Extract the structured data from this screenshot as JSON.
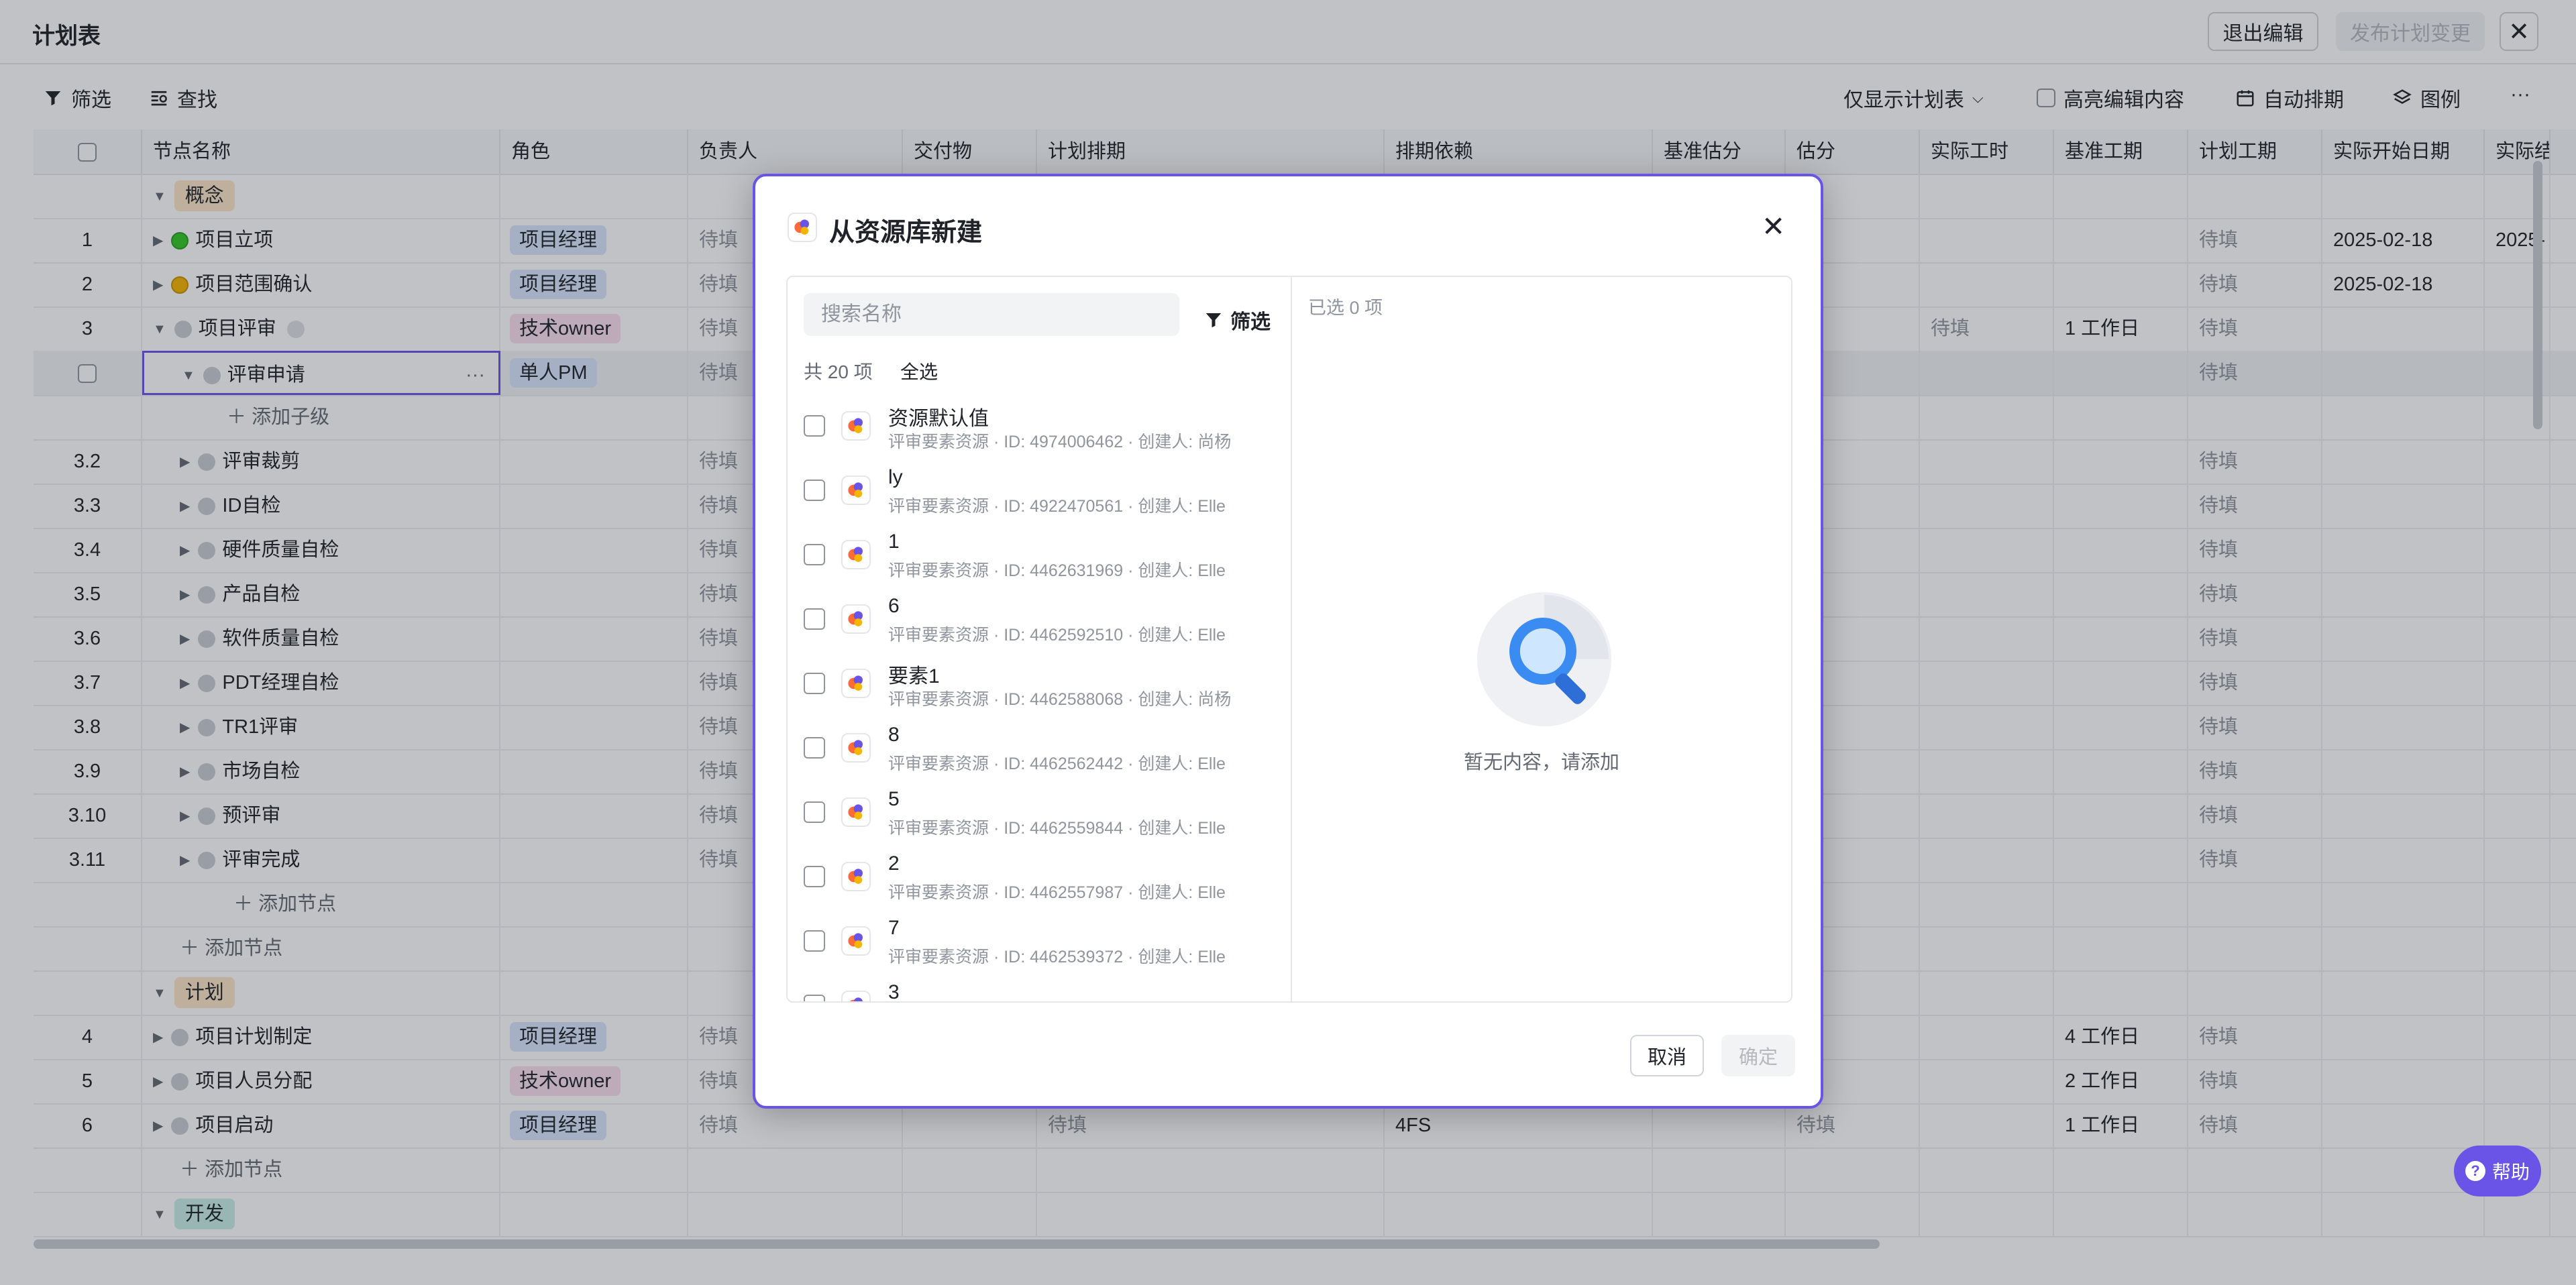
{
  "header": {
    "title": "计划表",
    "exit_edit": "退出编辑",
    "publish": "发布计划变更",
    "close": "✕"
  },
  "toolbar": {
    "filter": "筛选",
    "find": "查找",
    "show_plan_only": "仅显示计划表",
    "highlight_edits": "高亮编辑内容",
    "auto_schedule": "自动排期",
    "legend": "图例",
    "more": "···"
  },
  "table": {
    "columns": [
      "节点名称",
      "角色",
      "负责人",
      "交付物",
      "计划排期",
      "排期依赖",
      "基准估分",
      "估分",
      "实际工时",
      "基准工期",
      "计划工期",
      "实际开始日期",
      "实际结"
    ],
    "pending": "待填",
    "add_child": "添加子级",
    "add_node": "添加节点",
    "rows": [
      {
        "kind": "group",
        "label": "概念",
        "color": "concept"
      },
      {
        "kind": "node",
        "num": "1",
        "name": "项目立项",
        "dot": "green",
        "role": "项目经理",
        "role_color": "blue",
        "owner": "待填",
        "plan_dur": "待填",
        "start": "2025-02-18",
        "end": "2025-"
      },
      {
        "kind": "node",
        "num": "2",
        "name": "项目范围确认",
        "dot": "yellow",
        "role": "项目经理",
        "role_color": "blue",
        "owner": "待填",
        "plan_dur": "待填",
        "start": "2025-02-18"
      },
      {
        "kind": "node",
        "num": "3",
        "name": "项目评审",
        "dot": "gray",
        "role": "技术owner",
        "role_color": "pink",
        "owner": "待填",
        "actual_hours": "待填",
        "base_dur": "1 工作日",
        "plan_dur": "待填",
        "expanded": true
      },
      {
        "kind": "node",
        "num": "",
        "name": "评审申请",
        "dot": "gray",
        "role": "单人PM",
        "role_color": "blue",
        "owner": "待填",
        "plan_dur": "待填",
        "indent": 1,
        "selected": true
      },
      {
        "kind": "addchild"
      },
      {
        "kind": "node",
        "num": "3.2",
        "name": "评审裁剪",
        "dot": "gray",
        "owner": "待填",
        "plan_dur": "待填",
        "indent": 1
      },
      {
        "kind": "node",
        "num": "3.3",
        "name": "ID自检",
        "dot": "gray",
        "owner": "待填",
        "plan_dur": "待填",
        "indent": 1
      },
      {
        "kind": "node",
        "num": "3.4",
        "name": "硬件质量自检",
        "dot": "gray",
        "owner": "待填",
        "plan_dur": "待填",
        "indent": 1
      },
      {
        "kind": "node",
        "num": "3.5",
        "name": "产品自检",
        "dot": "gray",
        "owner": "待填",
        "plan_dur": "待填",
        "indent": 1
      },
      {
        "kind": "node",
        "num": "3.6",
        "name": "软件质量自检",
        "dot": "gray",
        "owner": "待填",
        "plan_dur": "待填",
        "indent": 1
      },
      {
        "kind": "node",
        "num": "3.7",
        "name": "PDT经理自检",
        "dot": "gray",
        "owner": "待填",
        "plan_dur": "待填",
        "indent": 1
      },
      {
        "kind": "node",
        "num": "3.8",
        "name": "TR1评审",
        "dot": "gray",
        "owner": "待填",
        "plan_dur": "待填",
        "indent": 1
      },
      {
        "kind": "node",
        "num": "3.9",
        "name": "市场自检",
        "dot": "gray",
        "owner": "待填",
        "plan_dur": "待填",
        "indent": 1
      },
      {
        "kind": "node",
        "num": "3.10",
        "name": "预评审",
        "dot": "gray",
        "owner": "待填",
        "plan_dur": "待填",
        "indent": 1
      },
      {
        "kind": "node",
        "num": "3.11",
        "name": "评审完成",
        "dot": "gray",
        "owner": "待填",
        "plan_dur": "待填",
        "indent": 1
      },
      {
        "kind": "addnode",
        "indent": 1
      },
      {
        "kind": "addnode",
        "indent": 0
      },
      {
        "kind": "group",
        "label": "计划",
        "color": "plan"
      },
      {
        "kind": "node",
        "num": "4",
        "name": "项目计划制定",
        "dot": "gray",
        "role": "项目经理",
        "role_color": "blue",
        "owner": "待填",
        "base_dur": "4 工作日",
        "plan_dur": "待填"
      },
      {
        "kind": "node",
        "num": "5",
        "name": "项目人员分配",
        "dot": "gray",
        "role": "技术owner",
        "role_color": "pink",
        "owner": "待填",
        "base_dur": "2 工作日",
        "plan_dur": "待填"
      },
      {
        "kind": "node",
        "num": "6",
        "name": "项目启动",
        "dot": "gray",
        "role": "项目经理",
        "role_color": "blue",
        "owner": "待填",
        "schedule": "待填",
        "dependency": "4FS",
        "estimate": "待填",
        "base_dur": "1 工作日",
        "plan_dur": "待填"
      },
      {
        "kind": "addnode",
        "indent": 0
      },
      {
        "kind": "group",
        "label": "开发",
        "color": "dev"
      }
    ]
  },
  "modal": {
    "title": "从资源库新建",
    "search_placeholder": "搜索名称",
    "filter": "筛选",
    "total": "共 20 项",
    "select_all": "全选",
    "selected": "已选 0 项",
    "empty": "暂无内容，请添加",
    "cancel": "取消",
    "confirm": "确定",
    "items": [
      {
        "name": "资源默认值",
        "sub": "评审要素资源 · ID: 4974006462 · 创建人: 尚杨"
      },
      {
        "name": "ly",
        "sub": "评审要素资源 · ID: 4922470561 · 创建人: Elle"
      },
      {
        "name": "1",
        "sub": "评审要素资源 · ID: 4462631969 · 创建人: Elle"
      },
      {
        "name": "6",
        "sub": "评审要素资源 · ID: 4462592510 · 创建人: Elle"
      },
      {
        "name": "要素1",
        "sub": "评审要素资源 · ID: 4462588068 · 创建人: 尚杨"
      },
      {
        "name": "8",
        "sub": "评审要素资源 · ID: 4462562442 · 创建人: Elle"
      },
      {
        "name": "5",
        "sub": "评审要素资源 · ID: 4462559844 · 创建人: Elle"
      },
      {
        "name": "2",
        "sub": "评审要素资源 · ID: 4462557987 · 创建人: Elle"
      },
      {
        "name": "7",
        "sub": "评审要素资源 · ID: 4462539372 · 创建人: Elle"
      },
      {
        "name": "3",
        "sub": ""
      }
    ]
  },
  "help": {
    "label": "帮助"
  },
  "colors": {
    "accent": "#6a54e8",
    "tag_blue": "#dbe6ff",
    "tag_pink": "#fbdff0"
  }
}
